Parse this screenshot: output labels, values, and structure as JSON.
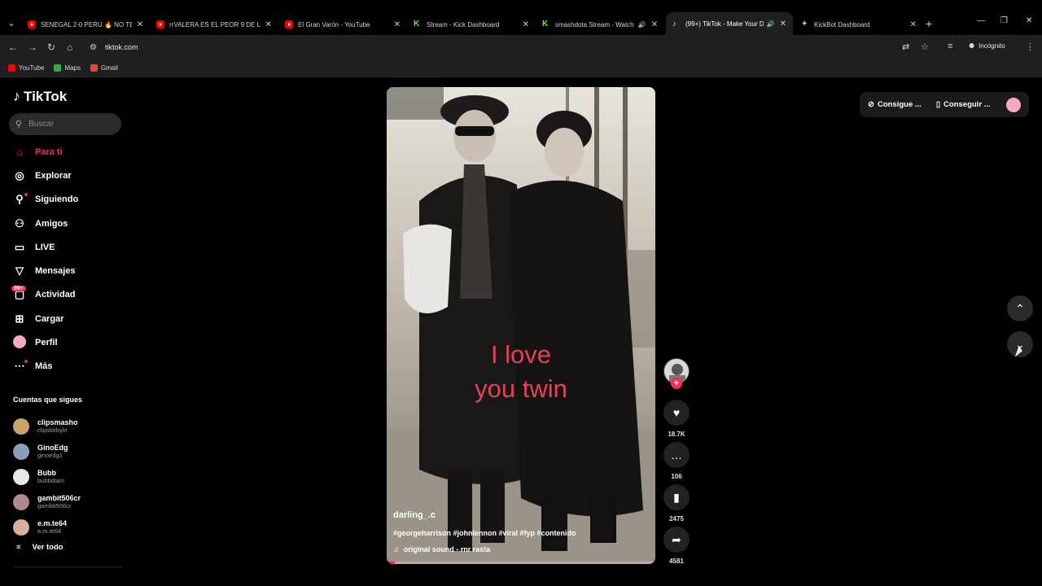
{
  "browser": {
    "tabs": [
      {
        "label": "SENEGAL 2-0 PERÚ 🔥 NO TENÍ",
        "favicon": "youtube-icon",
        "active": false
      },
      {
        "label": "rrVALERA ES EL PEOR 9 DE LA",
        "favicon": "youtube-icon",
        "active": false
      },
      {
        "label": "El Gran Varón - YouTube",
        "favicon": "youtube-icon",
        "active": false
      },
      {
        "label": "Stream - Kick Dashboard",
        "favicon": "kick-icon",
        "active": false
      },
      {
        "label": "smashdota Stream - Watch",
        "favicon": "kick-icon",
        "active": false
      },
      {
        "label": "(99+) TikTok - Make Your D",
        "favicon": "tiktok-icon",
        "active": true
      },
      {
        "label": "KickBot Dashboard",
        "favicon": "kickbot-icon",
        "active": false
      }
    ],
    "url": "tiktok.com",
    "incognito_label": "Incógnito",
    "bookmarks": [
      {
        "label": "YouTube",
        "color": "#ff0000"
      },
      {
        "label": "Maps",
        "color": "#34a853"
      },
      {
        "label": "Gmail",
        "color": "#ea4335"
      }
    ]
  },
  "tiktok": {
    "brand": "TikTok",
    "search_placeholder": "Buscar",
    "nav": [
      {
        "label": "Para ti",
        "icon": "home-icon",
        "glyph": "⌂",
        "active": true
      },
      {
        "label": "Explorar",
        "icon": "compass-icon",
        "glyph": "◎"
      },
      {
        "label": "Siguiendo",
        "icon": "following-icon",
        "glyph": "⚲",
        "dot": true
      },
      {
        "label": "Amigos",
        "icon": "friends-icon",
        "glyph": "⚇"
      },
      {
        "label": "LIVE",
        "icon": "live-icon",
        "glyph": "▭"
      },
      {
        "label": "Mensajes",
        "icon": "messages-icon",
        "glyph": "▽"
      },
      {
        "label": "Actividad",
        "icon": "activity-icon",
        "glyph": "▢",
        "badge": "99+"
      },
      {
        "label": "Cargar",
        "icon": "upload-icon",
        "glyph": "⊞"
      },
      {
        "label": "Perfil",
        "icon": "profile-avatar",
        "glyph": ""
      },
      {
        "label": "Más",
        "icon": "more-icon",
        "glyph": "⋯",
        "dot": true
      }
    ],
    "following_title": "Cuentas que sigues",
    "following": [
      {
        "name": "clipsmasho",
        "handle": "clipsklrbylo",
        "color": "#c9a46b"
      },
      {
        "name": "GinoEdg",
        "handle": "ginoedg1",
        "color": "#8aa0b8"
      },
      {
        "name": "Bubb",
        "handle": "bubbdlam",
        "color": "#e8e8e8"
      },
      {
        "name": "gambit506cr",
        "handle": "gambit506cr",
        "color": "#b08a8a"
      },
      {
        "name": "e.m.te64",
        "handle": "e.m.te64",
        "color": "#d8b0a0"
      }
    ],
    "see_all": "Ver todo",
    "video": {
      "overlay_line1": "I love",
      "overlay_line2": "you twin",
      "author": "darling_.c",
      "tags": "#georgeharrison #johnlennon #viral #fyp #contenido",
      "sound": "original sound - rnr rasta",
      "progress": 0.03
    },
    "actions": {
      "likes": "18.7K",
      "comments": "106",
      "saves": "2475",
      "shares": "4581"
    },
    "top_right": {
      "coins_label": "Consigue ...",
      "app_label": "Conseguir ..."
    },
    "accent": "#fe2c55"
  }
}
